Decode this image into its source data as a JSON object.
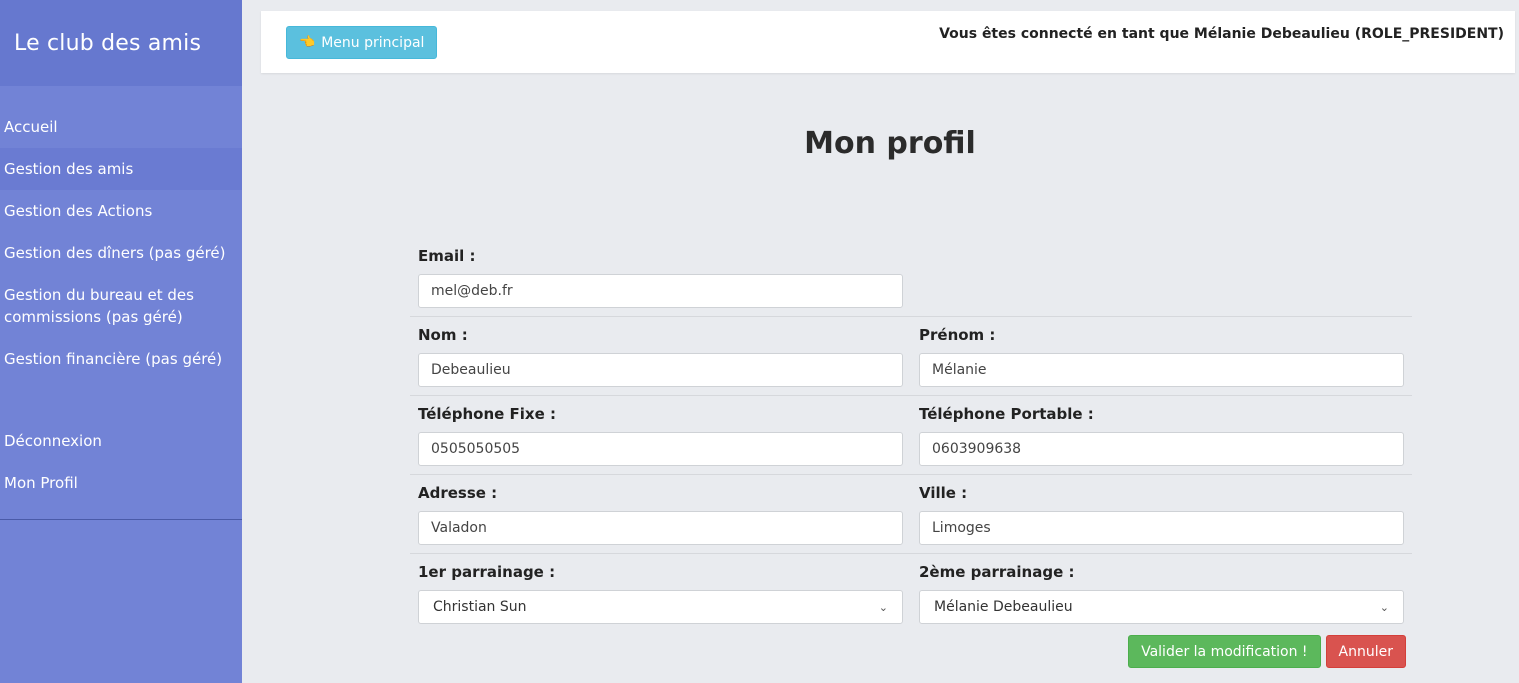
{
  "sidebar": {
    "brand": "Le club des amis",
    "items": [
      {
        "label": "Accueil"
      },
      {
        "label": "Gestion des amis"
      },
      {
        "label": "Gestion des Actions"
      },
      {
        "label": "Gestion des dîners (pas géré)"
      },
      {
        "label": "Gestion du bureau et des commissions (pas géré)"
      },
      {
        "label": "Gestion financière (pas géré)"
      }
    ],
    "bottom_items": [
      {
        "label": "Déconnexion"
      },
      {
        "label": "Mon Profil"
      }
    ]
  },
  "topbar": {
    "menu_button": "Menu principal",
    "menu_icon": "hand-pointing-icon",
    "user_info": "Vous êtes connecté en tant que Mélanie Debeaulieu (ROLE_PRESIDENT)"
  },
  "page": {
    "title": "Mon profil"
  },
  "form": {
    "email": {
      "label": "Email :",
      "value": "mel@deb.fr"
    },
    "nom": {
      "label": "Nom :",
      "value": "Debeaulieu"
    },
    "prenom": {
      "label": "Prénom :",
      "value": "Mélanie"
    },
    "tel_fixe": {
      "label": "Téléphone Fixe :",
      "value": "0505050505"
    },
    "tel_portable": {
      "label": "Téléphone Portable :",
      "value": "0603909638"
    },
    "adresse": {
      "label": "Adresse :",
      "value": "Valadon"
    },
    "ville": {
      "label": "Ville :",
      "value": "Limoges"
    },
    "parrainage1": {
      "label": "1er parrainage :",
      "value": "Christian Sun"
    },
    "parrainage2": {
      "label": "2ème parrainage :",
      "value": "Mélanie Debeaulieu"
    },
    "submit": "Valider la modification !",
    "cancel": "Annuler"
  },
  "colors": {
    "sidebar": "#7283d6",
    "brand_bg": "#6678cf",
    "info_button": "#5bc0de",
    "success_button": "#5cb85c",
    "danger_button": "#d9534f",
    "page_bg": "#e9ebef"
  }
}
